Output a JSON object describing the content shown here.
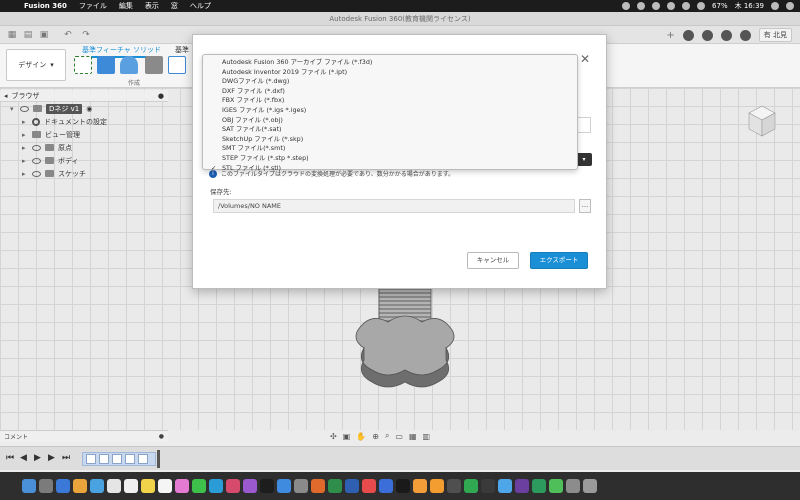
{
  "menubar": {
    "app_name": "Fusion 360",
    "items": [
      "ファイル",
      "編集",
      "表示",
      "窓",
      "ヘルプ"
    ],
    "battery": "67%",
    "clock": "木 16:39"
  },
  "window": {
    "title": "Autodesk Fusion 360(教育機関ライセンス)"
  },
  "toolbar": {
    "user_initials": "有 北見"
  },
  "ribbon": {
    "design_button": "デザイン",
    "tabs": [
      "基準フィーチャ ソリッド",
      "基準"
    ],
    "group_label": "作成"
  },
  "browser": {
    "title": "ブラウザ",
    "component": "Dネジ v1",
    "items": [
      "ドキュメントの設定",
      "ビュー管理",
      "原点",
      "ボディ",
      "スケッチ"
    ]
  },
  "comment_panel": {
    "title": "コメント"
  },
  "dialog": {
    "info_text": "このファイルタイプはクラウドの変換処理が必要であり、数分かかる場合があります。",
    "save_label": "保存先:",
    "save_path": "/Volumes/NO NAME",
    "browse_label": "...",
    "cancel_button": "キャンセル",
    "export_button": "エクスポート",
    "close_glyph": "✕"
  },
  "file_type_dropdown": {
    "options": [
      "Autodesk Fusion 360 アーカイブ ファイル (*.f3d)",
      "Autodesk Inventor 2019 ファイル (*.ipt)",
      "DWGファイル (*.dwg)",
      "DXF ファイル (*.dxf)",
      "FBX ファイル (*.fbx)",
      "IGES ファイル (*.igs *.iges)",
      "OBJ ファイル (*.obj)",
      "SAT ファイル(*.sat)",
      "SketchUp ファイル (*.skp)",
      "SMT ファイル(*.smt)",
      "STEP ファイル (*.stp *.step)",
      "STL ファイル (*.stl)"
    ],
    "selected": "STL ファイル (*.stl)",
    "check_glyph": "✓"
  },
  "colors": {
    "accent": "#1b8fd6",
    "dialog_bg": "#ffffff",
    "menubar_bg": "#1c1c1c",
    "dock_bg": "#2e2e2e"
  }
}
